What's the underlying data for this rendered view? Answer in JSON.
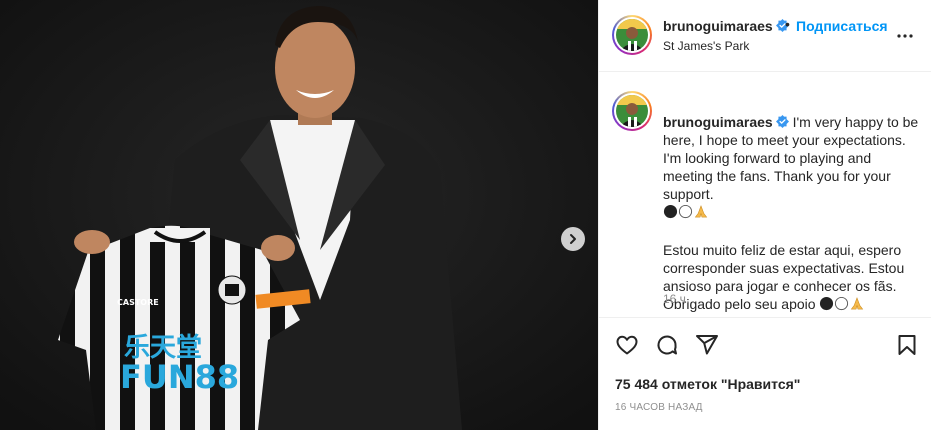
{
  "post": {
    "username": "brunoguimaraes",
    "dot": "•",
    "follow_label": "Подписаться",
    "location": "St James's Park",
    "caption_en": "I'm very happy to be here, I hope to meet your expectations. I'm looking forward to playing and meeting the fans. Thank you for your support.",
    "caption_pt": "Estou muito feliz de estar aqui, espero corresponder suas expectativas. Estou ansioso para jogar e conhecer os fãs. Obrigado pelo seu apoio",
    "caption_time": "16 ч.",
    "likes": "75 484 отметок \"Нравится\"",
    "posted_time": "16 часов назад"
  },
  "jersey": {
    "sponsor_cn": "乐天堂",
    "sponsor": "FUN88",
    "brand": "CASTORE"
  },
  "icons": {
    "verified": "verified-badge-icon",
    "more": "more-options-icon",
    "next": "chevron-right-icon",
    "like": "heart-icon",
    "comment": "comment-icon",
    "share": "share-icon",
    "save": "bookmark-icon"
  },
  "colors": {
    "accent": "#0095f6",
    "text": "#262626",
    "secondary": "#8e8e8e"
  }
}
